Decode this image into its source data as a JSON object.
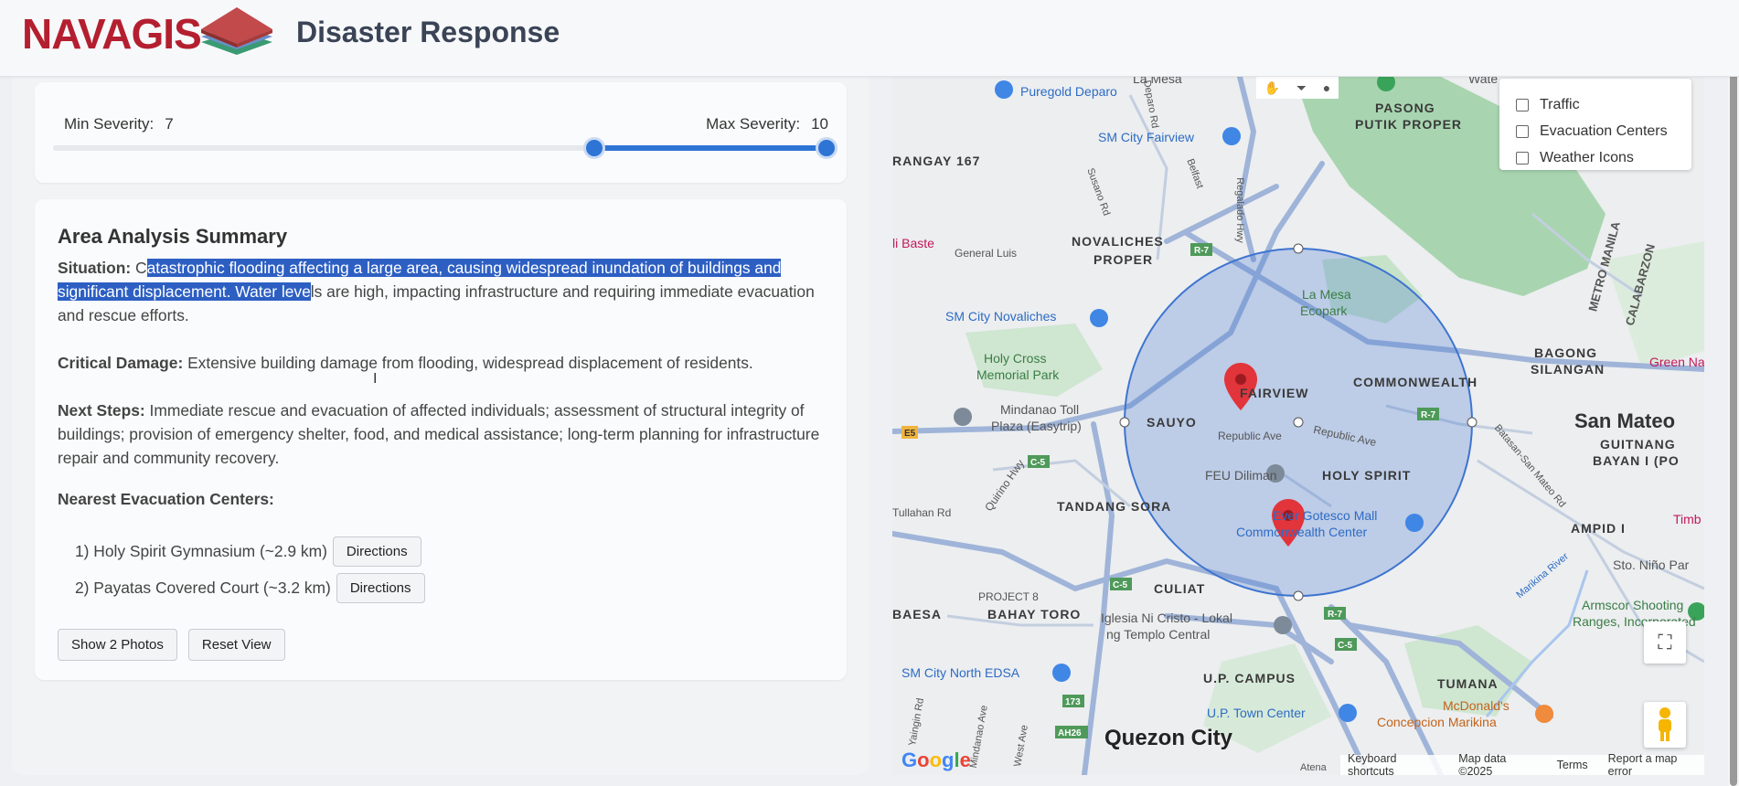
{
  "header": {
    "brand": "NAVAGIS",
    "title": "Disaster Response"
  },
  "severity": {
    "min_label": "Min Severity:",
    "min_value": "7",
    "max_label": "Max Severity:",
    "max_value": "10",
    "range_min": 0,
    "range_max": 10,
    "selected_min": 7,
    "selected_max": 10
  },
  "summary": {
    "title": "Area Analysis Summary",
    "situation_label": "Situation:",
    "situation_pre": "C",
    "situation_selected": "atastrophic flooding affecting a large area, causing widespread inundation of buildings and significant displacement. Water leve",
    "situation_post": "ls are high, impacting infrastructure and requiring immediate evacuation and rescue efforts.",
    "critical_label": "Critical Damage:",
    "critical_text": " Extensive building damage from flooding, widespread displacement of residents.",
    "next_label": "Next Steps:",
    "next_text": " Immediate rescue and evacuation of affected individuals; assessment of structural integrity of buildings; provision of emergency shelter, food, and medical assistance; long-term planning for infrastructure repair and community recovery.",
    "evac_heading": "Nearest Evacuation Centers:",
    "evac_centers": [
      {
        "text": "1) Holy Spirit Gymnasium (~2.9 km)",
        "button": "Directions"
      },
      {
        "text": "2) Payatas Covered Court (~3.2 km)",
        "button": "Directions"
      }
    ],
    "show_photos": "Show 2 Photos",
    "reset_view": "Reset View"
  },
  "map": {
    "layers": [
      "Traffic",
      "Evacuation Centers",
      "Weather Icons"
    ],
    "labels": {
      "puregold": "Puregold Deparo",
      "pasong": "PASONG",
      "putik": "PUTIK PROPER",
      "sm_fairview": "SM City Fairview",
      "rangay": "RANGAY 167",
      "basta": "li Baste",
      "general_luis": "General Luis",
      "novaliches": "NOVALICHES",
      "proper": "PROPER",
      "la_mesa": "La Mesa",
      "ecopark": "Ecopark",
      "metro_manila": "METRO MANILA",
      "calabarzon": "CALABARZON",
      "sm_novaliches": "SM City Novaliches",
      "holy_cross": "Holy Cross",
      "memorial_park": "Memorial Park",
      "fairview": "FAIRVIEW",
      "commonwealth": "COMMONWEALTH",
      "bagong": "BAGONG",
      "silangan": "SILANGAN",
      "green_na": "Green Na",
      "mindanao": "Mindanao Toll",
      "plaza": "Plaza (Easytrip)",
      "sauyo": "SAUYO",
      "republic_ave": "Republic Ave",
      "republic_ave2": "Republic Ave",
      "san_mateo": "San Mateo",
      "guitnang": "GUITNANG",
      "bayan": "BAYAN I (PO",
      "feu": "FEU Diliman",
      "holy_spirit": "HOLY SPIRIT",
      "tandang": "TANDANG SORA",
      "ever": "Ever Gotesco Mall",
      "cw_center": "Commonwealth Center",
      "ampid": "AMPID I",
      "timb": "Timb",
      "tullahan": "Tullahan Rd",
      "quirino": "Quirino Hwy",
      "project8": "PROJECT 8",
      "culiat": "CULIAT",
      "sto_nino": "Sto. Niño Par",
      "baesa": "BAESA",
      "bahay_toro": "BAHAY TORO",
      "iglesia": "Iglesia Ni Cristo - Lokal",
      "templo": "ng Templo Central",
      "armscor": "Armscor Shooting",
      "ranges": "Ranges, Incorporated",
      "sm_north": "SM City North EDSA",
      "up_campus": "U.P. CAMPUS",
      "tumana": "TUMANA",
      "up_town": "U.P. Town Center",
      "mcdonalds": "McDonald's",
      "concepcion": "Concepcion Marikina",
      "quezon": "Quezon City",
      "la_mesa_top": "La Mesa",
      "water": "Wate",
      "batasan": "Batasan-San Mateo Rd",
      "marikina_river": "Marikina River",
      "regalado": "Regalado Hwy",
      "belfast": "Belfast",
      "susano": "Susano Rd",
      "deparo": "Deparo Rd",
      "west_ave": "West Ave",
      "mindanao_ave": "Mindanao Ave",
      "yaingin": "Yaingin Rd",
      "atena": "Atena"
    },
    "shields": [
      "R-7",
      "E5",
      "C-5",
      "C-5",
      "R-7",
      "R-7",
      "C-5",
      "173",
      "AH26"
    ],
    "attribution": [
      "Keyboard shortcuts",
      "Map data ©2025",
      "Terms",
      "Report a map error"
    ],
    "google": "Google"
  }
}
